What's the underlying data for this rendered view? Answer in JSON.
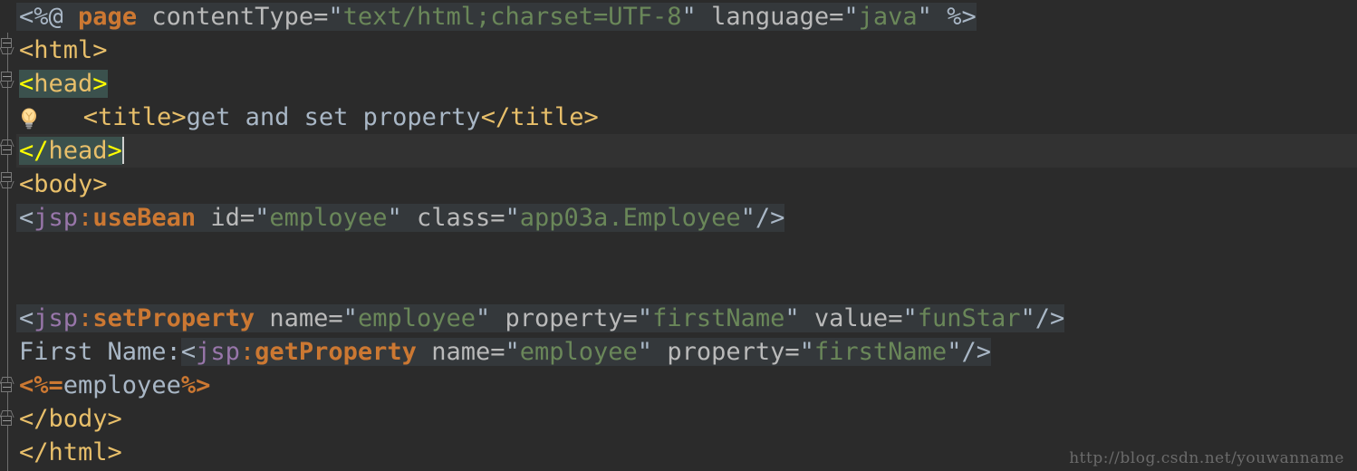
{
  "editor": {
    "theme_name": "darcula",
    "background_color": "#2b2b2b",
    "current_line_color": "#323232",
    "directive_block_color": "#34383b",
    "matched_tag_highlight_color": "#3b514d",
    "caret_color": "#cfcfcf"
  },
  "gutter": {
    "bulb_icon_name": "intention-lightbulb-icon",
    "fold_markers": [
      {
        "type": "fold-start",
        "line": 2
      },
      {
        "type": "fold-start",
        "line": 3
      },
      {
        "type": "fold-end",
        "line": 5
      },
      {
        "type": "fold-start",
        "line": 6
      },
      {
        "type": "fold-end",
        "line": 12
      },
      {
        "type": "fold-end",
        "line": 13
      }
    ]
  },
  "code": {
    "language": "JSP",
    "lines": [
      {
        "n": 1,
        "plain": "<%@ page contentType=\"text/html;charset=UTF-8\" language=\"java\" %>",
        "tokens": [
          {
            "text": "<%@",
            "kind": "punct"
          },
          {
            "text": " ",
            "kind": "punct"
          },
          {
            "text": "page",
            "kind": "keyword"
          },
          {
            "text": " contentType=",
            "kind": "attr"
          },
          {
            "text": "\"",
            "kind": "quote"
          },
          {
            "text": "text/html;charset=UTF-8",
            "kind": "string"
          },
          {
            "text": "\"",
            "kind": "quote"
          },
          {
            "text": " language=",
            "kind": "attr"
          },
          {
            "text": "\"",
            "kind": "quote"
          },
          {
            "text": "java",
            "kind": "string"
          },
          {
            "text": "\"",
            "kind": "quote"
          },
          {
            "text": " %>",
            "kind": "punct"
          }
        ]
      },
      {
        "n": 2,
        "plain": "<html>",
        "tokens": [
          {
            "text": "<html>",
            "kind": "tag"
          }
        ]
      },
      {
        "n": 3,
        "plain": "<head>",
        "tokens": [
          {
            "text": "<",
            "kind": "bracket-match"
          },
          {
            "text": "head",
            "kind": "tag-match"
          },
          {
            "text": ">",
            "kind": "bracket-match"
          }
        ]
      },
      {
        "n": 4,
        "plain": "    <title>get and set property</title>",
        "tokens": [
          {
            "text": "<title>",
            "kind": "tag"
          },
          {
            "text": "get and set property",
            "kind": "text"
          },
          {
            "text": "</title>",
            "kind": "tag"
          }
        ]
      },
      {
        "n": 5,
        "plain": "</head>",
        "tokens": [
          {
            "text": "</",
            "kind": "bracket-match"
          },
          {
            "text": "head",
            "kind": "tag-match"
          },
          {
            "text": ">",
            "kind": "bracket-match"
          }
        ]
      },
      {
        "n": 6,
        "plain": "<body>",
        "tokens": [
          {
            "text": "<body>",
            "kind": "tag"
          }
        ]
      },
      {
        "n": 7,
        "plain": "<jsp:useBean id=\"employee\" class=\"app03a.Employee\"/>",
        "tokens": [
          {
            "text": "<",
            "kind": "punct"
          },
          {
            "text": "jsp",
            "kind": "namespace"
          },
          {
            "text": ":",
            "kind": "colon"
          },
          {
            "text": "useBean",
            "kind": "keyword"
          },
          {
            "text": " id=",
            "kind": "attr"
          },
          {
            "text": "\"",
            "kind": "quote"
          },
          {
            "text": "employee",
            "kind": "string"
          },
          {
            "text": "\"",
            "kind": "quote"
          },
          {
            "text": " class=",
            "kind": "attr"
          },
          {
            "text": "\"",
            "kind": "quote"
          },
          {
            "text": "app03a.Employee",
            "kind": "string"
          },
          {
            "text": "\"",
            "kind": "quote"
          },
          {
            "text": "/>",
            "kind": "punct"
          }
        ]
      },
      {
        "n": 8,
        "plain": "",
        "tokens": []
      },
      {
        "n": 9,
        "plain": "",
        "tokens": []
      },
      {
        "n": 10,
        "plain": "<jsp:setProperty name=\"employee\" property=\"firstName\" value=\"funStar\"/>",
        "tokens": [
          {
            "text": "<",
            "kind": "punct"
          },
          {
            "text": "jsp",
            "kind": "namespace"
          },
          {
            "text": ":",
            "kind": "colon"
          },
          {
            "text": "setProperty",
            "kind": "keyword"
          },
          {
            "text": " name=",
            "kind": "attr"
          },
          {
            "text": "\"",
            "kind": "quote"
          },
          {
            "text": "employee",
            "kind": "string"
          },
          {
            "text": "\"",
            "kind": "quote"
          },
          {
            "text": " property=",
            "kind": "attr"
          },
          {
            "text": "\"",
            "kind": "quote"
          },
          {
            "text": "firstName",
            "kind": "string"
          },
          {
            "text": "\"",
            "kind": "quote"
          },
          {
            "text": " value=",
            "kind": "attr"
          },
          {
            "text": "\"",
            "kind": "quote"
          },
          {
            "text": "funStar",
            "kind": "string"
          },
          {
            "text": "\"",
            "kind": "quote"
          },
          {
            "text": "/>",
            "kind": "punct"
          }
        ]
      },
      {
        "n": 11,
        "plain": "First Name:<jsp:getProperty name=\"employee\" property=\"firstName\"/>",
        "tokens": [
          {
            "text": "First Name:",
            "kind": "text"
          },
          {
            "text": "<",
            "kind": "punct"
          },
          {
            "text": "jsp",
            "kind": "namespace"
          },
          {
            "text": ":",
            "kind": "colon"
          },
          {
            "text": "getProperty",
            "kind": "keyword"
          },
          {
            "text": " name=",
            "kind": "attr"
          },
          {
            "text": "\"",
            "kind": "quote"
          },
          {
            "text": "employee",
            "kind": "string"
          },
          {
            "text": "\"",
            "kind": "quote"
          },
          {
            "text": " property=",
            "kind": "attr"
          },
          {
            "text": "\"",
            "kind": "quote"
          },
          {
            "text": "firstName",
            "kind": "string"
          },
          {
            "text": "\"",
            "kind": "quote"
          },
          {
            "text": "/>",
            "kind": "punct"
          }
        ]
      },
      {
        "n": 12,
        "plain": "<%=employee%>",
        "tokens": [
          {
            "text": "<%=",
            "kind": "scriptlet"
          },
          {
            "text": "employee",
            "kind": "expr"
          },
          {
            "text": "%>",
            "kind": "scriptlet"
          }
        ]
      },
      {
        "n": 13,
        "plain": "</body>",
        "tokens": [
          {
            "text": "</body>",
            "kind": "tag"
          }
        ]
      },
      {
        "n": 14,
        "plain": "</html>",
        "tokens": [
          {
            "text": "</html>",
            "kind": "tag"
          }
        ]
      }
    ]
  },
  "watermark": {
    "text": "http://blog.csdn.net/youwanname"
  }
}
